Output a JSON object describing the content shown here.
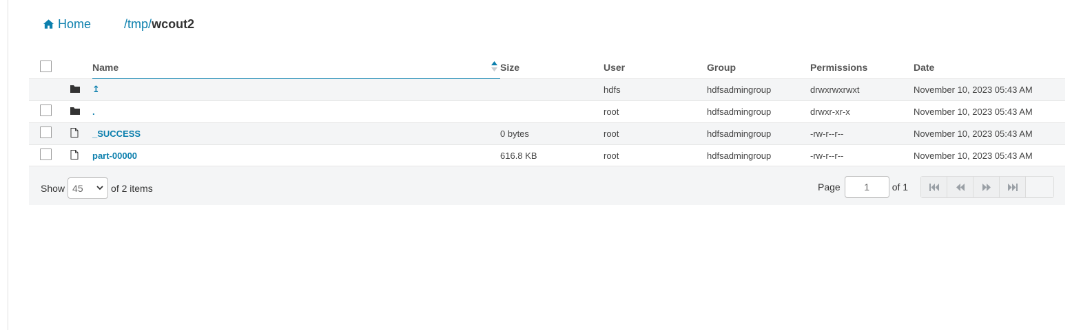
{
  "breadcrumbs": {
    "home_label": "Home",
    "path_root_sep": "/",
    "path_segment": "tmp",
    "path_sep": "/",
    "current": "wcout2"
  },
  "table": {
    "columns": [
      "Name",
      "Size",
      "User",
      "Group",
      "Permissions",
      "Date"
    ],
    "sorted_column": "Name",
    "rows": [
      {
        "type": "folder",
        "name": "↥",
        "size": "",
        "user": "hdfs",
        "group": "hdfsadmingroup",
        "permissions": "drwxrwxrwxt",
        "date": "November 10, 2023 05:43 AM",
        "checkbox": false
      },
      {
        "type": "folder",
        "name": ".",
        "size": "",
        "user": "root",
        "group": "hdfsadmingroup",
        "permissions": "drwxr-xr-x",
        "date": "November 10, 2023 05:43 AM",
        "checkbox": true
      },
      {
        "type": "file",
        "name": "_SUCCESS",
        "size": "0 bytes",
        "user": "root",
        "group": "hdfsadmingroup",
        "permissions": "-rw-r--r--",
        "date": "November 10, 2023 05:43 AM",
        "checkbox": true
      },
      {
        "type": "file",
        "name": "part-00000",
        "size": "616.8 KB",
        "user": "root",
        "group": "hdfsadmingroup",
        "permissions": "-rw-r--r--",
        "date": "November 10, 2023 05:43 AM",
        "checkbox": true
      }
    ]
  },
  "footer": {
    "show_label": "Show",
    "page_size": "45",
    "items_label": "of 2 items",
    "page_label": "Page",
    "page_value": "1",
    "of_pages": "of 1"
  },
  "colors": {
    "accent": "#0b7fad",
    "row_alt": "#f4f5f6"
  },
  "icons": {
    "home": "home-icon",
    "folder": "folder-icon",
    "file": "file-icon",
    "first": "first-page-icon",
    "prev": "previous-page-icon",
    "next": "next-page-icon",
    "last": "last-page-icon"
  }
}
